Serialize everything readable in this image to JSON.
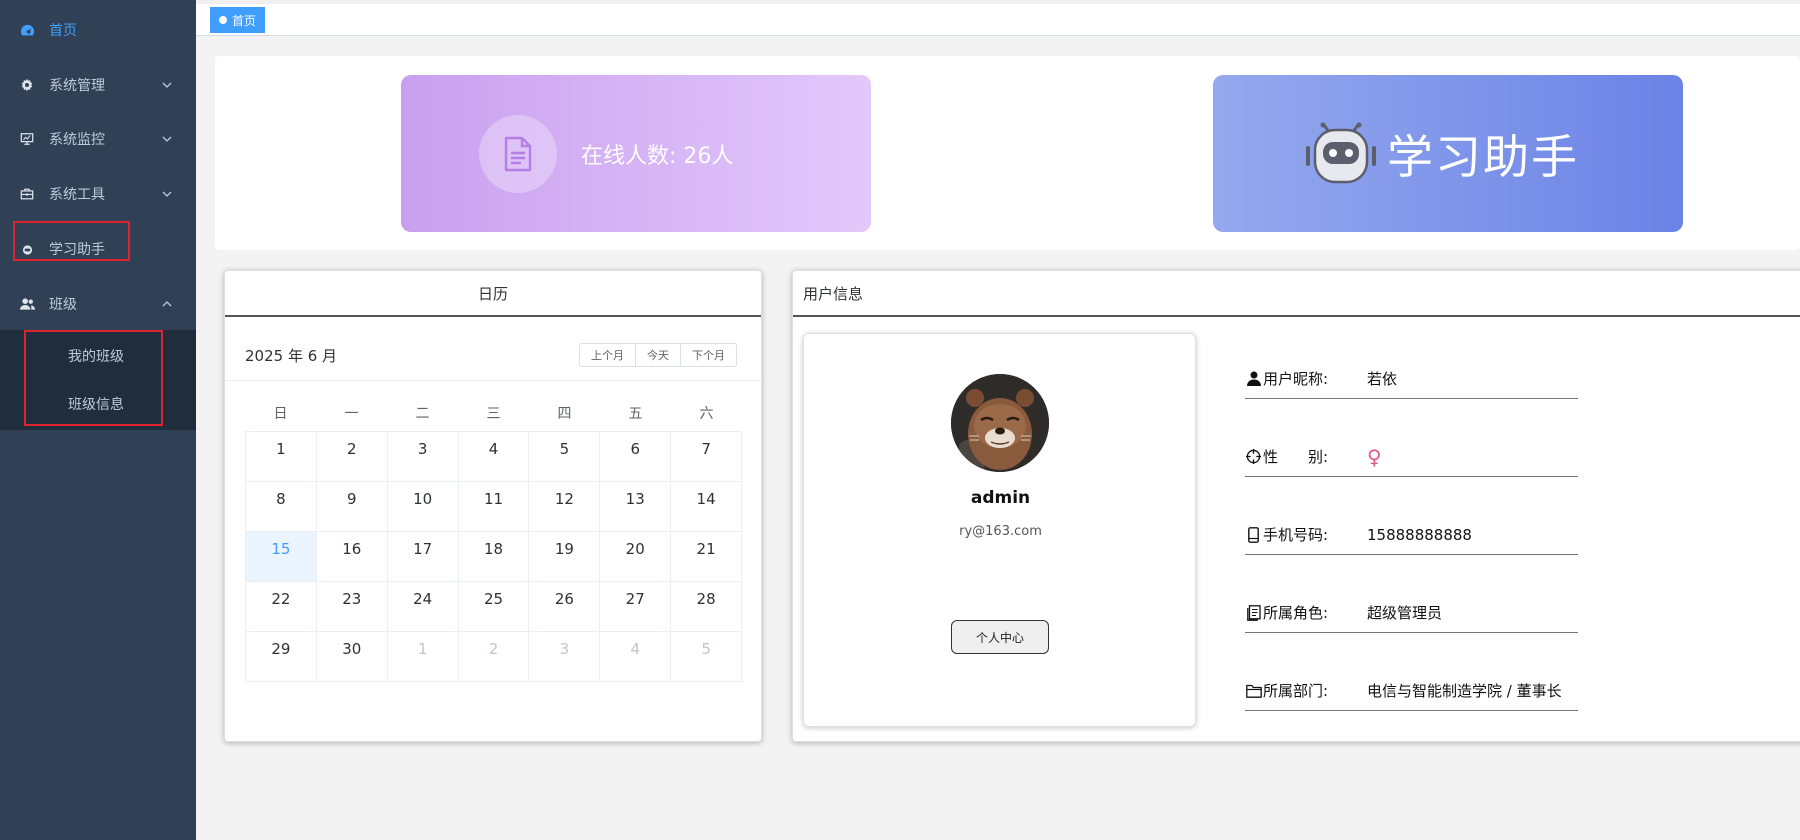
{
  "sidebar": {
    "items": [
      {
        "label": "首页",
        "icon": "dashboard-icon"
      },
      {
        "label": "系统管理",
        "icon": "gear-icon"
      },
      {
        "label": "系统监控",
        "icon": "monitor-icon"
      },
      {
        "label": "系统工具",
        "icon": "toolbox-icon"
      },
      {
        "label": "学习助手",
        "icon": "assistant-icon"
      },
      {
        "label": "班级",
        "icon": "users-icon"
      }
    ],
    "subitems": [
      {
        "label": "我的班级"
      },
      {
        "label": "班级信息"
      }
    ]
  },
  "tags": {
    "home": "首页"
  },
  "cards": {
    "online": "在线人数: 26人",
    "assistant": "学习助手"
  },
  "calendar": {
    "panel_title": "日历",
    "title": "2025 年 6 月",
    "prev": "上个月",
    "today": "今天",
    "next": "下个月",
    "weekdays": [
      "日",
      "一",
      "二",
      "三",
      "四",
      "五",
      "六"
    ],
    "weeks": [
      [
        "1",
        "2",
        "3",
        "4",
        "5",
        "6",
        "7"
      ],
      [
        "8",
        "9",
        "10",
        "11",
        "12",
        "13",
        "14"
      ],
      [
        "15",
        "16",
        "17",
        "18",
        "19",
        "20",
        "21"
      ],
      [
        "22",
        "23",
        "24",
        "25",
        "26",
        "27",
        "28"
      ],
      [
        "29",
        "30",
        "1",
        "2",
        "3",
        "4",
        "5"
      ]
    ],
    "today_value": "15"
  },
  "user": {
    "panel_title": "用户信息",
    "name": "admin",
    "email": "ry@163.com",
    "center_button": "个人中心",
    "fields": [
      {
        "label": "用户昵称:",
        "value": "若依"
      },
      {
        "label": "性　　别:",
        "value": "♀"
      },
      {
        "label": "手机号码:",
        "value": "15888888888"
      },
      {
        "label": "所属角色:",
        "value": "超级管理员"
      },
      {
        "label": "所属部门:",
        "value": "电信与智能制造学院 / 董事长"
      }
    ]
  },
  "colors": {
    "sidebar_bg": "#304156",
    "submenu_bg": "#1f2d3d",
    "accent": "#409eff",
    "highlight_box": "#e0242f"
  }
}
